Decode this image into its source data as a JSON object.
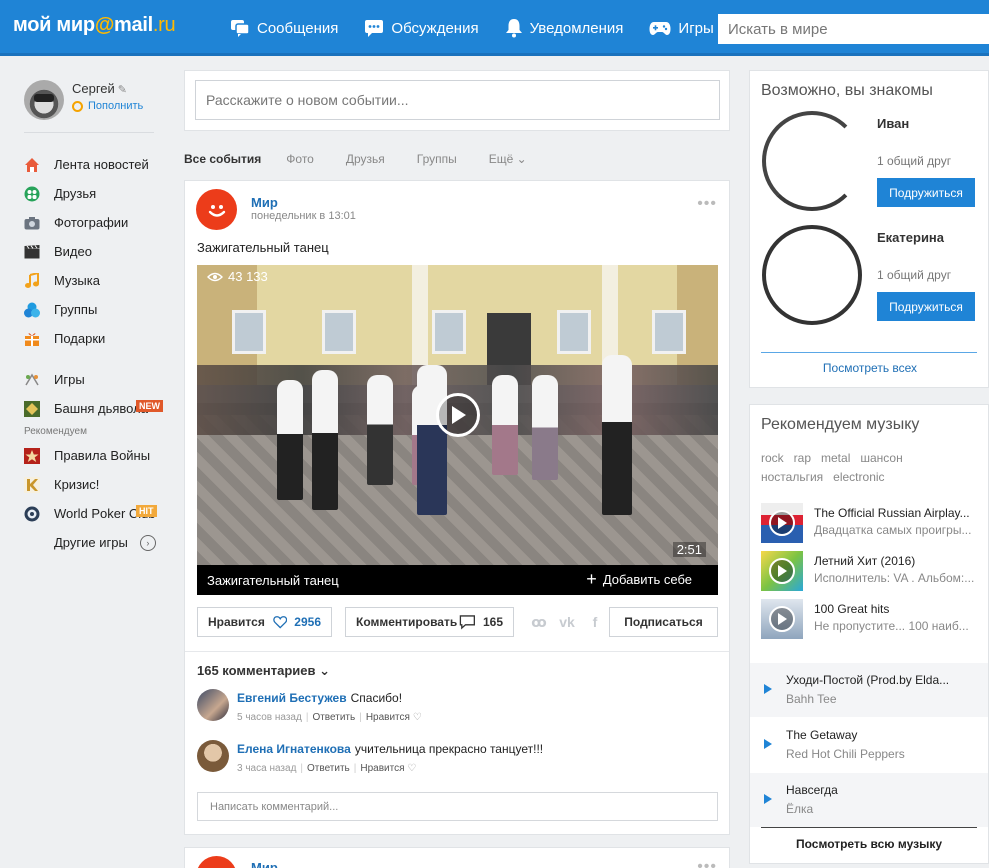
{
  "header": {
    "logo_text": "мой мир",
    "logo_at": "@",
    "logo_mail": "mail",
    "logo_ru": ".ru",
    "nav": [
      {
        "label": "Сообщения",
        "icon": "messages-icon"
      },
      {
        "label": "Обсуждения",
        "icon": "discussions-icon"
      },
      {
        "label": "Уведомления",
        "icon": "bell-icon"
      },
      {
        "label": "Игры",
        "icon": "gamepad-icon"
      }
    ],
    "search_placeholder": "Искать в мире"
  },
  "profile": {
    "name": "Сергей",
    "topup_label": "Пополнить"
  },
  "sidebar": {
    "menu": [
      {
        "label": "Лента новостей",
        "icon": "home-icon"
      },
      {
        "label": "Друзья",
        "icon": "friends-icon"
      },
      {
        "label": "Фотографии",
        "icon": "camera-icon"
      },
      {
        "label": "Видео",
        "icon": "video-icon"
      },
      {
        "label": "Музыка",
        "icon": "music-icon"
      },
      {
        "label": "Группы",
        "icon": "groups-icon"
      },
      {
        "label": "Подарки",
        "icon": "gift-icon"
      }
    ],
    "games_label": "Игры",
    "games": [
      {
        "label": "Башня дьявола",
        "badge": "NEW"
      }
    ],
    "recommended_label": "Рекомендуем",
    "rec_games": [
      {
        "label": "Правила Войны",
        "badge": ""
      },
      {
        "label": "Кризис!",
        "badge": ""
      },
      {
        "label": "World Poker Club",
        "badge": "HIT"
      }
    ],
    "more_games": "Другие игры"
  },
  "composer": {
    "placeholder": "Расскажите о новом событии..."
  },
  "filters": [
    "Все события",
    "Фото",
    "Друзья",
    "Группы",
    "Ещё"
  ],
  "post": {
    "author": "Мир",
    "time": "понедельник в 13:01",
    "text": "Зажигательный танец",
    "video": {
      "views": "43 133",
      "duration": "2:51",
      "title": "Зажигательный танец",
      "add_label": "Добавить себе"
    },
    "like_label": "Нравится",
    "like_count": "2956",
    "comment_label": "Комментировать",
    "comment_count": "165",
    "subscribe_label": "Подписаться",
    "comments_header": "165 комментариев",
    "comments": [
      {
        "name": "Евгений Бестужев",
        "text": "Спасибо!",
        "time": "5 часов назад",
        "reply": "Ответить",
        "like": "Нравится"
      },
      {
        "name": "Елена Игнатенкова",
        "text": "учительница прекрасно танцует!!!",
        "time": "3 часа назад",
        "reply": "Ответить",
        "like": "Нравится"
      }
    ],
    "comment_placeholder": "Написать комментарий..."
  },
  "post2": {
    "author": "Мир"
  },
  "friends": {
    "title": "Возможно, вы знакомы",
    "items": [
      {
        "name": "Иван",
        "mutual": "1 общий друг",
        "button": "Подружиться"
      },
      {
        "name": "Екатерина",
        "mutual": "1 общий друг",
        "button": "Подружиться"
      }
    ],
    "see_all": "Посмотреть всех"
  },
  "music": {
    "title": "Рекомендуем музыку",
    "genres": [
      "rock",
      "rap",
      "metal",
      "шансон",
      "ностальгия",
      "electronic"
    ],
    "albums": [
      {
        "title": "The Official Russian Airplay...",
        "sub": "Двадцатка самых проигры..."
      },
      {
        "title": "Летний Хит (2016)",
        "sub": "Исполнитель: VA . Альбом:..."
      },
      {
        "title": "100 Great hits",
        "sub": "Не пропустите... 100 наиб..."
      }
    ],
    "tracks": [
      {
        "title": "Уходи-Постой (Prod.by Elda...",
        "artist": "Bahh Tee"
      },
      {
        "title": "The Getaway",
        "artist": "Red Hot Chili Peppers"
      },
      {
        "title": "Навсегда",
        "artist": "Ёлка"
      }
    ],
    "see_all": "Посмотреть всю музыку"
  },
  "colors": {
    "brand_blue": "#1f84d6",
    "accent_orange": "#ffb900",
    "post_avatar_red": "#ec3c1a"
  }
}
